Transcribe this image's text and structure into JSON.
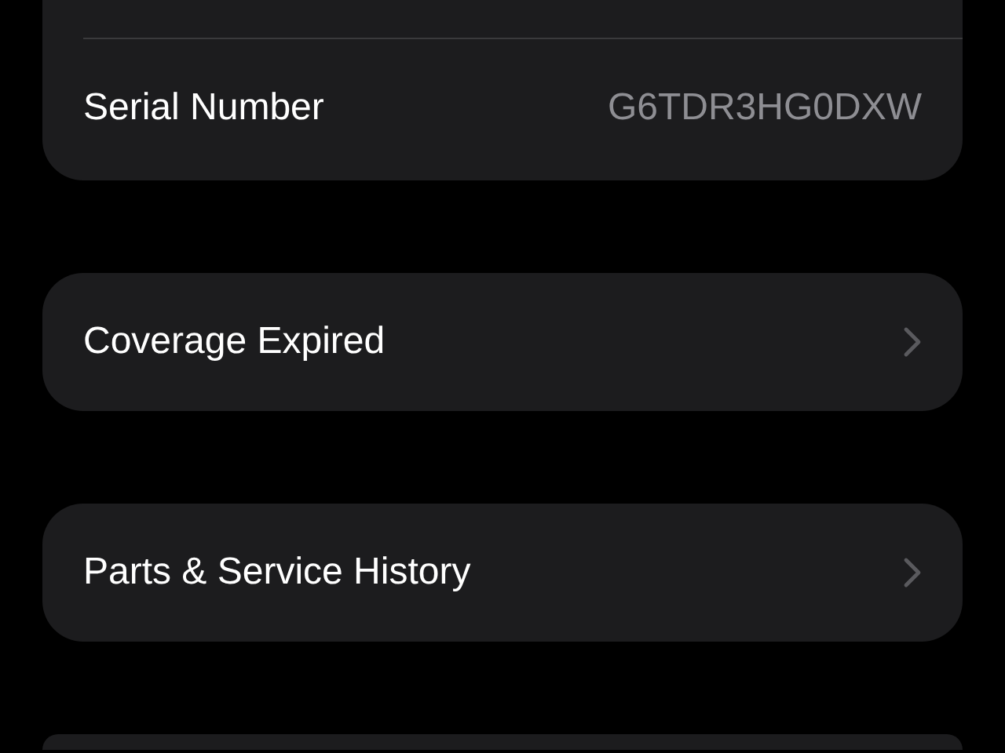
{
  "cards": [
    {
      "kind": "info",
      "label": "Serial Number",
      "value": "G6TDR3HG0DXW"
    },
    {
      "kind": "link",
      "label": "Coverage Expired"
    },
    {
      "kind": "link",
      "label": "Parts & Service History"
    },
    {
      "kind": "empty"
    }
  ]
}
